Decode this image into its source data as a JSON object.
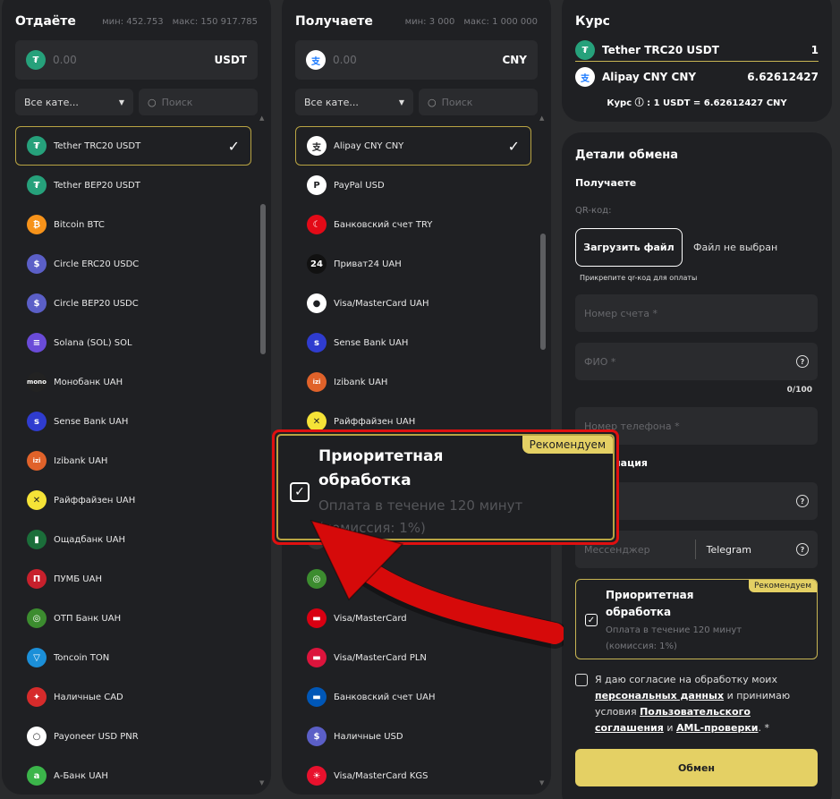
{
  "give": {
    "title": "Отдаёте",
    "min": "мин: 452.753",
    "max": "макс: 150 917.785",
    "amount": "0.00",
    "currency": "USDT",
    "category": "Все кате...",
    "search_placeholder": "Поиск",
    "items": [
      {
        "label": "Tether TRC20 USDT",
        "icon": "tether-icon",
        "color": "#26a17b",
        "glyph": "₮",
        "selected": true
      },
      {
        "label": "Tether BEP20 USDT",
        "icon": "tether-icon",
        "color": "#26a17b",
        "glyph": "₮"
      },
      {
        "label": "Bitcoin BTC",
        "icon": "bitcoin-icon",
        "color": "#f7931a",
        "glyph": "₿"
      },
      {
        "label": "Circle ERC20 USDC",
        "icon": "usdc-icon",
        "color": "#5b5fc7",
        "glyph": "$"
      },
      {
        "label": "Circle BEP20 USDC",
        "icon": "usdc-icon",
        "color": "#5b5fc7",
        "glyph": "$"
      },
      {
        "label": "Solana (SOL) SOL",
        "icon": "solana-icon",
        "color": "#6a4bd8",
        "glyph": "≡"
      },
      {
        "label": "Монобанк UAH",
        "icon": "monobank-icon",
        "color": "#222",
        "glyph": "mono"
      },
      {
        "label": "Sense Bank UAH",
        "icon": "sense-bank-icon",
        "color": "#2f3ccf",
        "glyph": "s"
      },
      {
        "label": "Izibank UAH",
        "icon": "izibank-icon",
        "color": "#e0622a",
        "glyph": "izi"
      },
      {
        "label": "Райффайзен UAH",
        "icon": "raiffeisen-icon",
        "color": "#f5e337",
        "glyph": "✕"
      },
      {
        "label": "Ощадбанк UAH",
        "icon": "oschadbank-icon",
        "color": "#1b6e3a",
        "glyph": "▮"
      },
      {
        "label": "ПУМБ UAH",
        "icon": "pumb-icon",
        "color": "#c7202c",
        "glyph": "П"
      },
      {
        "label": "ОТП Банк UAH",
        "icon": "otp-icon",
        "color": "#3c8c2f",
        "glyph": "◎"
      },
      {
        "label": "Toncoin TON",
        "icon": "toncoin-icon",
        "color": "#1b8fd8",
        "glyph": "▽"
      },
      {
        "label": "Наличные CAD",
        "icon": "canada-flag-icon",
        "color": "#d62b2b",
        "glyph": "✦"
      },
      {
        "label": "Payoneer USD PNR",
        "icon": "payoneer-icon",
        "color": "#ffffff",
        "glyph": "○"
      },
      {
        "label": "А-Банк UAH",
        "icon": "a-bank-icon",
        "color": "#3bb54a",
        "glyph": "a"
      }
    ]
  },
  "receive": {
    "title": "Получаете",
    "min": "мин: 3 000",
    "max": "макс: 1 000 000",
    "amount": "0.00",
    "currency": "CNY",
    "category": "Все кате...",
    "search_placeholder": "Поиск",
    "items": [
      {
        "label": "Alipay CNY CNY",
        "icon": "alipay-icon",
        "color": "#ffffff",
        "glyph": "支",
        "selected": true
      },
      {
        "label": "PayPal USD",
        "icon": "paypal-icon",
        "color": "#ffffff",
        "glyph": "P"
      },
      {
        "label": "Банковский счет TRY",
        "icon": "turkey-flag-icon",
        "color": "#e30a17",
        "glyph": "☾"
      },
      {
        "label": "Приват24 UAH",
        "icon": "privat24-icon",
        "color": "#111",
        "glyph": "24"
      },
      {
        "label": "Visa/MasterCard UAH",
        "icon": "visa-mastercard-icon",
        "color": "#ffffff",
        "glyph": "●"
      },
      {
        "label": "Sense Bank UAH",
        "icon": "sense-bank-icon",
        "color": "#2f3ccf",
        "glyph": "s"
      },
      {
        "label": "Izibank UAH",
        "icon": "izibank-icon",
        "color": "#e0622a",
        "glyph": "izi"
      },
      {
        "label": "Райффайзен UAH",
        "icon": "raiffeisen-icon",
        "color": "#f5e337",
        "glyph": "✕"
      },
      {
        "label": "",
        "icon": "hidden-item-icon",
        "color": "#333",
        "glyph": ""
      },
      {
        "label": "",
        "icon": "hidden-item-icon",
        "color": "#333",
        "glyph": ""
      },
      {
        "label": "",
        "icon": "hidden-item-icon",
        "color": "#333",
        "glyph": ""
      },
      {
        "label": "",
        "icon": "otp-icon",
        "color": "#3c8c2f",
        "glyph": "◎"
      },
      {
        "label": "Visa/MasterCard",
        "icon": "armenia-flag-icon",
        "color": "#d90012",
        "glyph": "▬"
      },
      {
        "label": "Visa/MasterCard PLN",
        "icon": "poland-flag-icon",
        "color": "#dc143c",
        "glyph": "▬"
      },
      {
        "label": "Банковский счет UAH",
        "icon": "ukraine-flag-icon",
        "color": "#0057b7",
        "glyph": "▬"
      },
      {
        "label": "Наличные USD",
        "icon": "cash-usd-icon",
        "color": "#5b5fc7",
        "glyph": "$"
      },
      {
        "label": "Visa/MasterCard KGS",
        "icon": "kyrgyzstan-flag-icon",
        "color": "#e8112d",
        "glyph": "☀"
      }
    ]
  },
  "rate": {
    "title": "Курс",
    "from_label": "Tether TRC20 USDT",
    "from_value": "1",
    "to_label": "Alipay CNY CNY",
    "to_value": "6.62612427",
    "note": "Курс ⓘ : 1 USDT = 6.62612427 CNY"
  },
  "details": {
    "title": "Детали обмена",
    "section": "Получаете",
    "qr_label": "QR-код:",
    "upload_button": "Загрузить файл",
    "no_file": "Файл не выбран",
    "hint": "Прикрепите qr-код для оплаты",
    "account_placeholder": "Номер счета *",
    "fio_placeholder": "ФИО *",
    "counter": "0/100",
    "phone_placeholder": "Номер телефона *",
    "additional_info": "информация",
    "messenger_placeholder": "Мессенджер",
    "messenger_value": "Telegram",
    "priority_title": "Приоритетная обработка",
    "priority_desc_1": "Оплата в течение 120 минут",
    "priority_desc_2": "(комиссия: 1%)",
    "recommend": "Рекомендуем",
    "consent_1": "Я даю согласие на обработку моих",
    "consent_link1": "персональных данных",
    "consent_2": " и принимаю условия ",
    "consent_link2": "Пользовательского соглашения",
    "consent_3": " и ",
    "consent_link3": "AML-проверки",
    "consent_4": ". *",
    "submit": "Обмен"
  },
  "popup": {
    "title": "Приоритетная обработка",
    "desc_1": "Оплата в течение 120 минут",
    "desc_2": "(комиссия: 1%)",
    "recommend": "Рекомендуем"
  }
}
